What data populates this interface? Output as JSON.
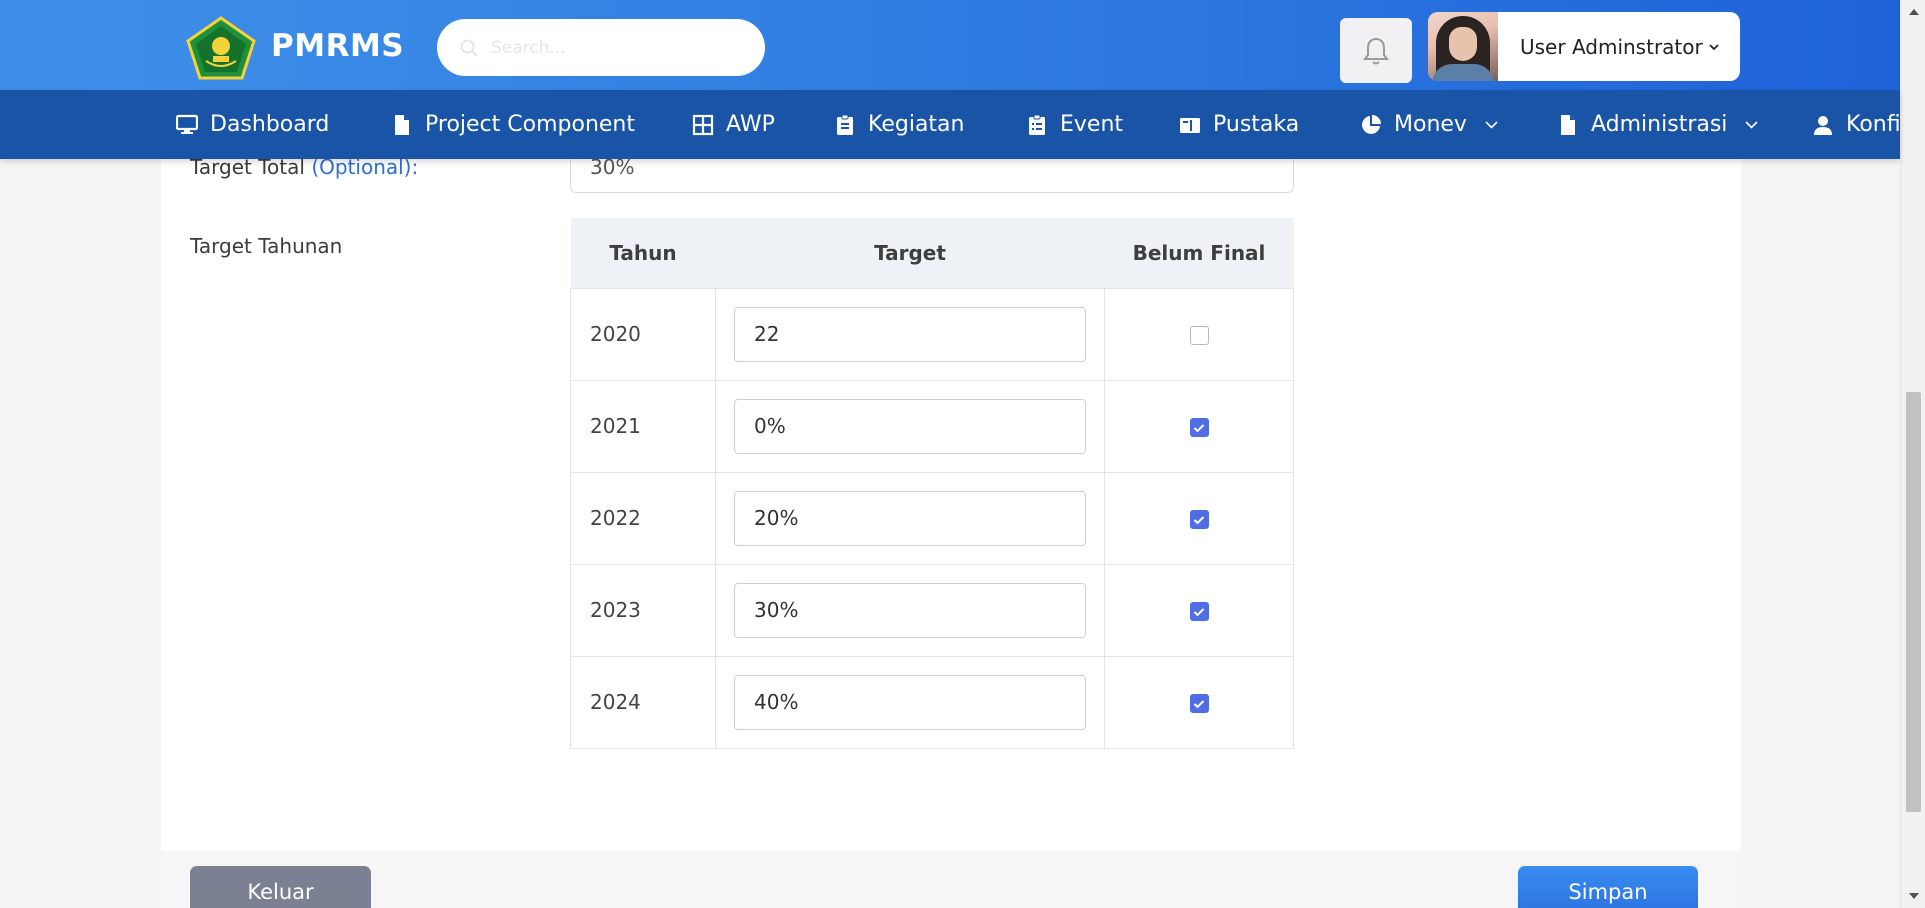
{
  "header": {
    "brand": "PMRMS",
    "search_placeholder": "Search...",
    "user_name": "User Adminstrator",
    "user_caret": "›"
  },
  "nav": {
    "items": [
      {
        "label": "Dashboard",
        "icon": "monitor-icon"
      },
      {
        "label": "Project Component",
        "icon": "document-icon"
      },
      {
        "label": "AWP",
        "icon": "grid-icon"
      },
      {
        "label": "Kegiatan",
        "icon": "clipboard-icon"
      },
      {
        "label": "Event",
        "icon": "clipboard-list-icon"
      },
      {
        "label": "Pustaka",
        "icon": "book-icon"
      },
      {
        "label": "Monev",
        "icon": "pie-chart-icon",
        "has_dropdown": true
      },
      {
        "label": "Administrasi",
        "icon": "document-icon",
        "has_dropdown": true
      },
      {
        "label": "Konfi",
        "icon": "user-icon"
      }
    ]
  },
  "form": {
    "target_total_label": "Target Total",
    "target_total_optional": "(Optional)",
    "target_total_colon": ":",
    "target_total_value": "30%",
    "target_tahunan_label": "Target Tahunan",
    "table": {
      "headers": [
        "Tahun",
        "Target",
        "Belum Final"
      ],
      "rows": [
        {
          "year": "2020",
          "target": "22",
          "belum_final": false
        },
        {
          "year": "2021",
          "target": "0%",
          "belum_final": true
        },
        {
          "year": "2022",
          "target": "20%",
          "belum_final": true
        },
        {
          "year": "2023",
          "target": "30%",
          "belum_final": true
        },
        {
          "year": "2024",
          "target": "40%",
          "belum_final": true
        }
      ]
    }
  },
  "buttons": {
    "keluar": "Keluar",
    "simpan": "Simpan"
  },
  "colors": {
    "header_gradient_start": "#3f8fe8",
    "navbar": "#1954a6",
    "checkbox_checked": "#4f6ee6",
    "btn_keluar": "#7b8193",
    "btn_simpan": "#2a72e0",
    "optional_text": "#2f6ed6"
  }
}
